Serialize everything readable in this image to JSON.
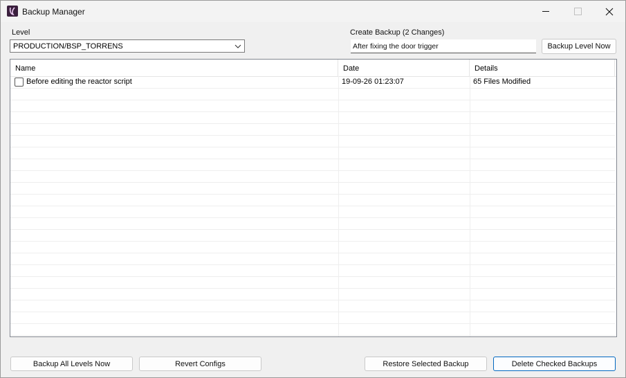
{
  "window": {
    "title": "Backup Manager",
    "app_icon": "app-logo-icon",
    "controls": [
      "minimize-icon",
      "maximize-icon",
      "close-icon"
    ]
  },
  "level": {
    "label": "Level",
    "selected": "PRODUCTION/BSP_TORRENS"
  },
  "create_backup": {
    "label": "Create Backup (2 Changes)",
    "value": "After fixing the door trigger",
    "button": "Backup Level Now"
  },
  "table": {
    "columns": [
      "Name",
      "Date",
      "Details"
    ],
    "rows": [
      {
        "checked": false,
        "name": "Before editing the reactor script",
        "date": "19-09-26 01:23:07",
        "details": "65 Files Modified"
      }
    ]
  },
  "footer": {
    "backup_all": "Backup All Levels Now",
    "revert_configs": "Revert Configs",
    "restore_selected": "Restore Selected Backup",
    "delete_checked": "Delete Checked Backups"
  },
  "colors": {
    "accent": "#0067c0",
    "window_bg": "#f0f0f0",
    "app_icon_bg": "#3a1f3d"
  }
}
